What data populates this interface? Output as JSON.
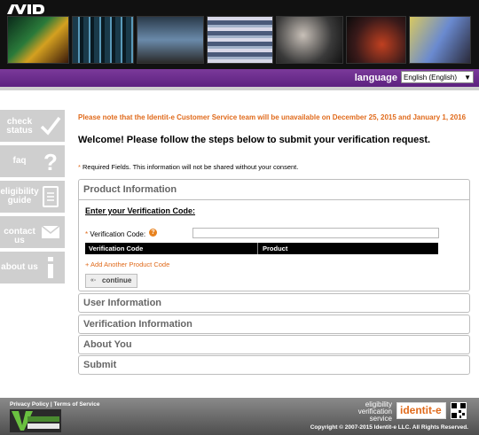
{
  "header": {
    "brand": "AVID",
    "language_label": "language",
    "language_value": "English (English)"
  },
  "sidebar": [
    {
      "label_line1": "check",
      "label_line2": "status",
      "icon": "checkmark-icon"
    },
    {
      "label_line1": "faq",
      "label_line2": "",
      "icon": "question-icon"
    },
    {
      "label_line1": "eligibility",
      "label_line2": "guide",
      "icon": "document-icon"
    },
    {
      "label_line1": "contact us",
      "label_line2": "",
      "icon": "envelope-icon"
    },
    {
      "label_line1": "about us",
      "label_line2": "",
      "icon": "info-icon"
    }
  ],
  "main": {
    "notice": "Please note that the Identit-e Customer Service team will be unavailable on December 25, 2015 and January 1, 2016",
    "welcome": "Welcome! Please follow the steps below to submit your verification request.",
    "required_star": "*",
    "required_text": "Required Fields. This information will not be shared without your consent.",
    "product_panel": {
      "title": "Product Information",
      "enter_code": "Enter your Verification Code:",
      "field_star": "*",
      "field_label": "Verification Code:",
      "help_icon": "?",
      "input_value": "",
      "columns": [
        "Verification Code",
        "Product"
      ],
      "add_link": "+ Add Another Product Code",
      "continue_arrow": "«-",
      "continue_label": "continue"
    },
    "sections": [
      "User Information",
      "Verification Information",
      "About You",
      "Submit"
    ]
  },
  "footer": {
    "privacy_policy": "Privacy Policy",
    "separator": "|",
    "terms": "Terms of Service",
    "eligibility_service": [
      "eligibility",
      "verification",
      "service"
    ],
    "identite_logo": "identit-e",
    "copyright": "Copyright © 2007-2015 Identit-e LLC. All Rights Reserved."
  },
  "colors": {
    "accent_orange": "#e06a1b",
    "purple_bar": "#6b2a8c",
    "sidebar_gray": "#cfcfcf"
  }
}
